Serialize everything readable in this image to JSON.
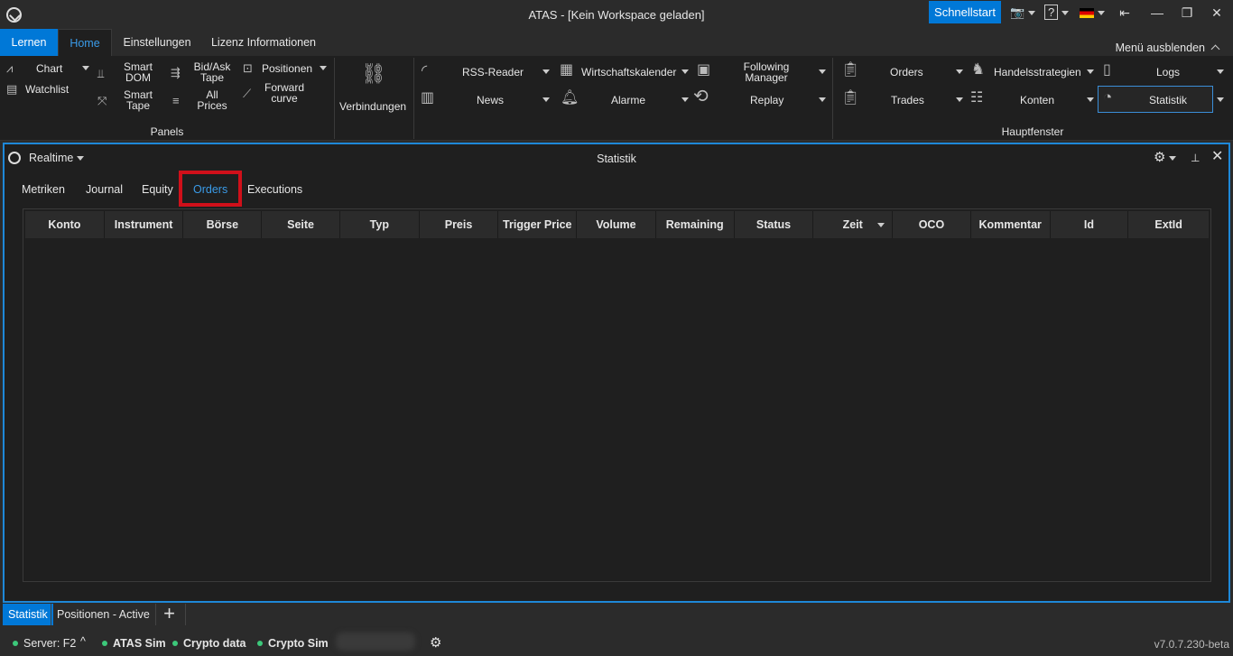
{
  "window": {
    "title": "ATAS - [Kein Workspace geladen]",
    "schnellstart": "Schnellstart"
  },
  "ribbon_tabs": [
    "Lernen",
    "Home",
    "Einstellungen",
    "Lizenz Informationen"
  ],
  "menu_hide": "Menü ausblenden",
  "panels_group": {
    "label": "Panels",
    "chart": "Chart",
    "watchlist": "Watchlist",
    "smart_dom_1": "Smart",
    "smart_dom_2": "DOM",
    "smart_tape_1": "Smart",
    "smart_tape_2": "Tape",
    "bidask_1": "Bid/Ask",
    "bidask_2": "Tape",
    "allprices_1": "All",
    "allprices_2": "Prices",
    "positionen": "Positionen",
    "forward_1": "Forward",
    "forward_2": "curve"
  },
  "verbindungen": "Verbindungen",
  "tools": {
    "rss": "RSS-Reader",
    "news": "News",
    "wirtschaft": "Wirtschaftskalender",
    "alarme": "Alarme",
    "following_1": "Following",
    "following_2": "Manager",
    "replay": "Replay"
  },
  "hauptfenster": {
    "label": "Hauptfenster",
    "orders": "Orders",
    "trades": "Trades",
    "handel": "Handelsstrategien",
    "konten": "Konten",
    "logs": "Logs",
    "statistik": "Statistik"
  },
  "panel": {
    "mode": "Realtime",
    "title": "Statistik",
    "subtabs": [
      "Metriken",
      "Journal",
      "Equity",
      "Orders",
      "Executions"
    ],
    "active_subtab": "Orders",
    "columns": [
      "Konto",
      "Instrument",
      "Börse",
      "Seite",
      "Typ",
      "Preis",
      "Trigger Price",
      "Volume",
      "Remaining",
      "Status",
      "Zeit",
      "OCO",
      "Kommentar",
      "Id",
      "ExtId"
    ]
  },
  "bottom_tabs": [
    "Statistik",
    "Positionen - Active"
  ],
  "status": {
    "server": "Server: F2",
    "atas_sim": "ATAS Sim",
    "crypto_data": "Crypto data",
    "crypto_sim": "Crypto Sim",
    "version": "v7.0.7.230-beta"
  },
  "colors": {
    "accent": "#0078d7",
    "active_text": "#3a9be8",
    "highlight": "#d0101a",
    "status_ok": "#3cc87a"
  }
}
